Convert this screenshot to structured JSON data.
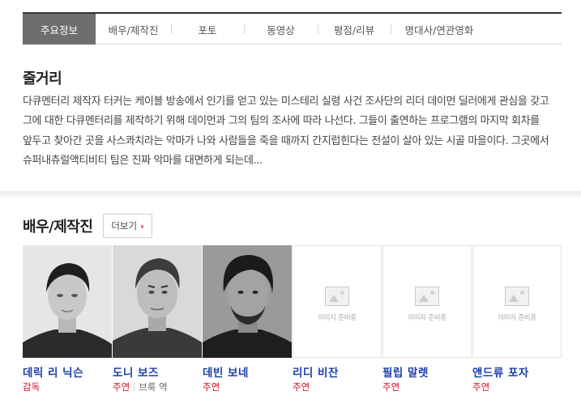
{
  "tabs": [
    {
      "label": "주요정보",
      "active": true
    },
    {
      "label": "배우/제작진",
      "active": false
    },
    {
      "label": "포토",
      "active": false
    },
    {
      "label": "동영상",
      "active": false
    },
    {
      "label": "평점/리뷰",
      "active": false
    },
    {
      "label": "명대사/연관영화",
      "active": false
    }
  ],
  "synopsis": {
    "title": "줄거리",
    "text": "다큐멘터리 제작자 터커는 케이블 방송에서 인기를 얻고 있는 미스테리 실령 사건 조사단의 리더 데이먼 딜러에게 관심을 갖고 그에 대한 다큐멘터리를 제작하기 위해 데이먼과 그의 팀의 조사에 따라 나선다. 그들이 출연하는 프로그램의 마지막 회차를 앞두고 찾아간 곳을 사스콰치라는 악마가 나와 사람들을 죽을 때까지 간지럽힌다는 전설이 살아 있는 시골 마을이다. 그곳에서 슈퍼내츄럴액티비티 팀은 진짜 악마를 대면하게 되는데..."
  },
  "cast": {
    "title": "배우/제작진",
    "more_label": "더보기",
    "placeholder_text": "이미지 준비중",
    "members": [
      {
        "name": "데릭 리 닉슨",
        "role": "감독",
        "character": ""
      },
      {
        "name": "도니 보즈",
        "role": "주연",
        "character": "브룩 역"
      },
      {
        "name": "데빈 보네",
        "role": "주연",
        "character": ""
      },
      {
        "name": "리디 비잔",
        "role": "주연",
        "character": ""
      },
      {
        "name": "필립 말렛",
        "role": "주연",
        "character": ""
      },
      {
        "name": "앤드류 포자",
        "role": "주연",
        "character": ""
      }
    ]
  },
  "colors": {
    "accent_red": "#e3001b",
    "name_blue": "#1c3fa6",
    "active_tab": "#6e6e6e"
  }
}
